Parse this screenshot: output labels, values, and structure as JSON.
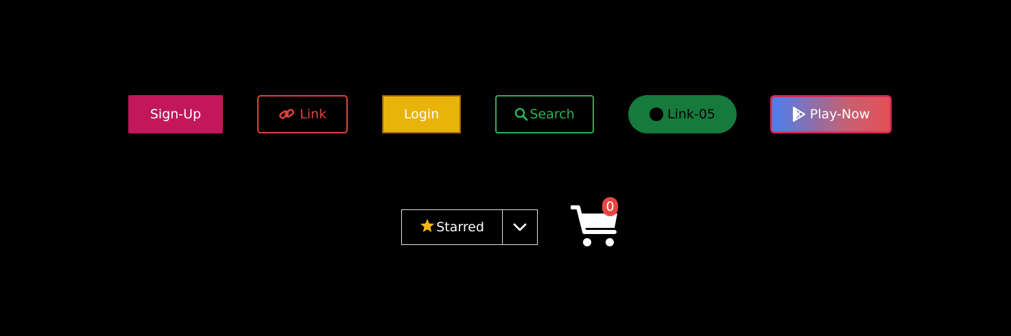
{
  "buttons": {
    "signup": {
      "label": "Sign-Up",
      "color": "#c2185b"
    },
    "link": {
      "label": "Link",
      "icon": "link-icon",
      "color": "#e0453a"
    },
    "login": {
      "label": "Login",
      "color": "#e8b40a"
    },
    "search": {
      "label": "Search",
      "icon": "search-icon",
      "color": "#2bb352"
    },
    "link05": {
      "label": "Link-05",
      "icon": "circle-icon",
      "color": "#157a3c"
    },
    "play": {
      "label": "Play-Now",
      "icon": "play-store-icon",
      "gradient": [
        "#4a7fee",
        "#e45056"
      ]
    }
  },
  "starred": {
    "label": "Starred",
    "icon": "star-icon",
    "toggle_icon": "chevron-down-icon"
  },
  "cart": {
    "icon": "shopping-cart-icon",
    "count": "0",
    "badge_color": "#e84540"
  }
}
